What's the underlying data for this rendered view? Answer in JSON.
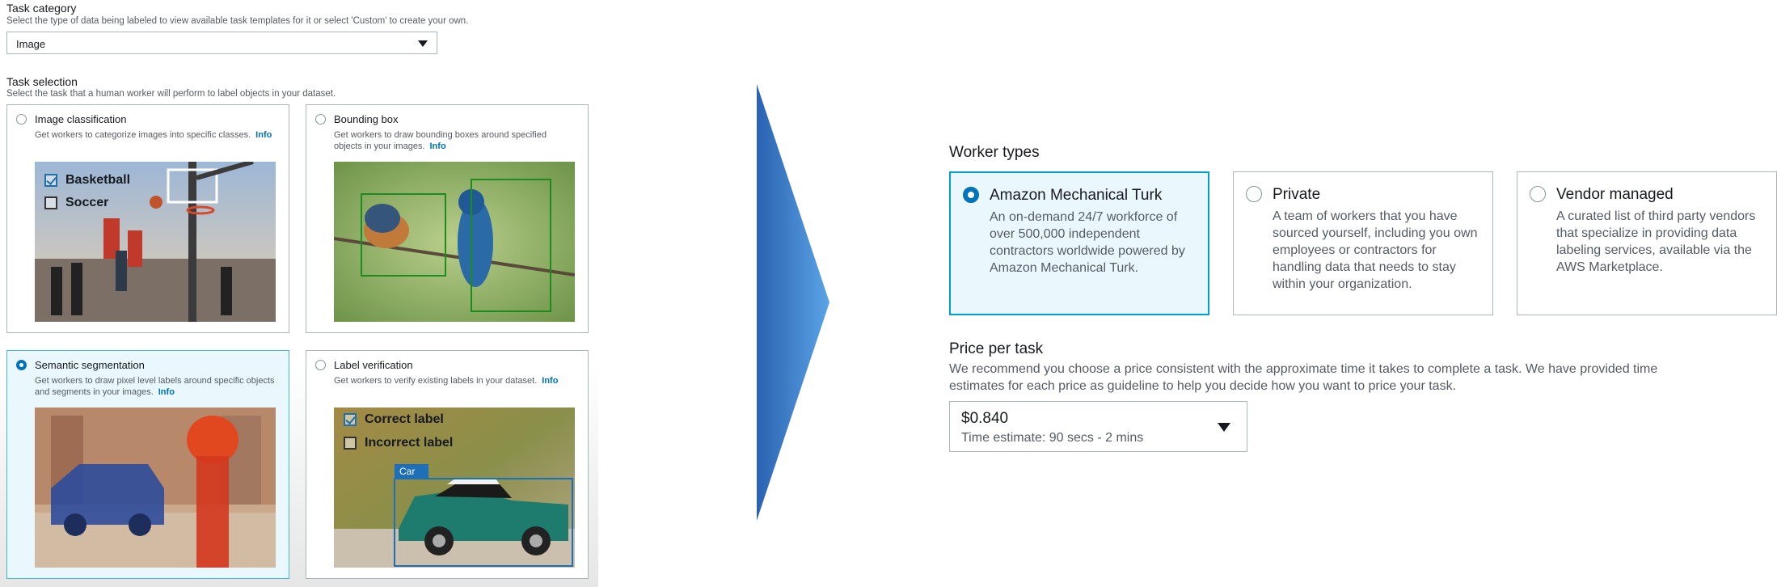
{
  "task_category": {
    "title": "Task category",
    "description": "Select the type of data being labeled to view available task templates for it or select 'Custom' to create your own.",
    "selected": "Image"
  },
  "task_selection": {
    "title": "Task selection",
    "description": "Select the task that a human worker will perform to label objects in your dataset.",
    "info_label": "Info",
    "cards": [
      {
        "title": "Image classification",
        "description": "Get workers to categorize images into specific classes.",
        "selected": false,
        "labels": [
          "Basketball",
          "Soccer"
        ]
      },
      {
        "title": "Bounding box",
        "description": "Get workers to draw bounding boxes around specified objects in your images.",
        "selected": false
      },
      {
        "title": "Semantic segmentation",
        "description": "Get workers to draw pixel level labels around specific objects and segments in your images.",
        "selected": true
      },
      {
        "title": "Label verification",
        "description": "Get workers to verify existing labels in your dataset.",
        "selected": false,
        "labels": [
          "Correct label",
          "Incorrect label"
        ],
        "box_tag": "Car"
      }
    ]
  },
  "worker_types": {
    "title": "Worker types",
    "options": [
      {
        "title": "Amazon Mechanical Turk",
        "description": "An on-demand 24/7 workforce of over 500,000 independent contractors worldwide powered by Amazon Mechanical Turk.",
        "selected": true
      },
      {
        "title": "Private",
        "description": "A team of workers that you have sourced yourself, including you own employees or contractors for handling data that needs to stay within your organization.",
        "selected": false
      },
      {
        "title": "Vendor managed",
        "description": "A curated list of third party vendors that specialize in providing data labeling services, available via the AWS Marketplace.",
        "selected": false
      }
    ]
  },
  "price_per_task": {
    "title": "Price per task",
    "description": "We recommend you choose a price consistent with the approximate time it takes to complete a task. We have provided time estimates for each price as guideline to help you decide how you want to price your task.",
    "selected_price": "$0.840",
    "time_estimate": "Time estimate: 90 secs - 2 mins"
  },
  "colors": {
    "accent": "#0073bb",
    "selected_bg": "#eaf7fd",
    "selected_border": "#00a1c9",
    "arrow": "#3a7fcf"
  }
}
